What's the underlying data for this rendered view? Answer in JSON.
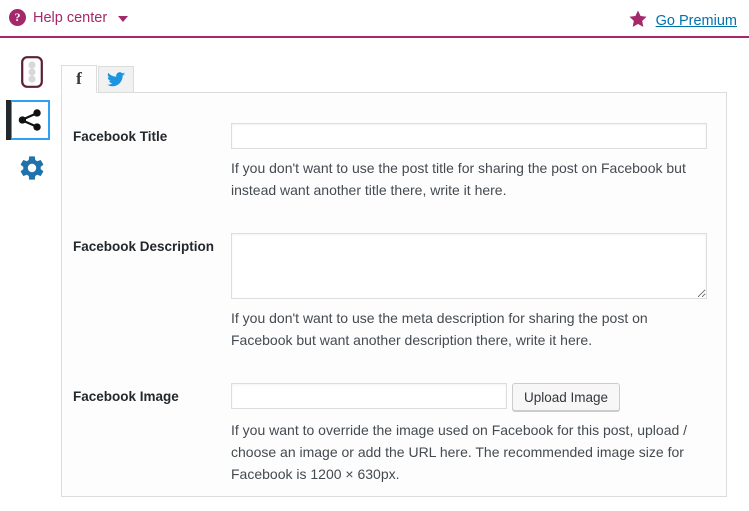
{
  "topbar": {
    "help_icon": "question-mark-circle-icon",
    "help_label": "Help center",
    "caret_icon": "chevron-down-icon",
    "star_icon": "star-icon",
    "premium_label": "Go Premium",
    "accent_color": "#a4286a",
    "link_color": "#0073aa"
  },
  "sidebar": {
    "items": [
      {
        "name": "seo-traffic-light-icon",
        "label": "SEO analysis",
        "active": false
      },
      {
        "name": "share-icon",
        "label": "Social",
        "active": true
      },
      {
        "name": "gear-icon",
        "label": "Settings",
        "active": false
      }
    ],
    "active_border_color": "#2ea2f2"
  },
  "tabs": [
    {
      "name": "tab-facebook",
      "icon": "facebook-icon",
      "label": "f",
      "active": true
    },
    {
      "name": "tab-twitter",
      "icon": "twitter-bird-icon",
      "label": "",
      "active": false
    }
  ],
  "form": {
    "title": {
      "label": "Facebook Title",
      "value": "",
      "placeholder": "",
      "help": "If you don't want to use the post title for sharing the post on Facebook but instead want another title there, write it here."
    },
    "description": {
      "label": "Facebook Description",
      "value": "",
      "placeholder": "",
      "help": "If you don't want to use the meta description for sharing the post on Facebook but want another description there, write it here."
    },
    "image": {
      "label": "Facebook Image",
      "value": "",
      "placeholder": "",
      "button_label": "Upload Image",
      "help": "If you want to override the image used on Facebook for this post, upload / choose an image or add the URL here. The recommended image size for Facebook is 1200 × 630px."
    }
  }
}
